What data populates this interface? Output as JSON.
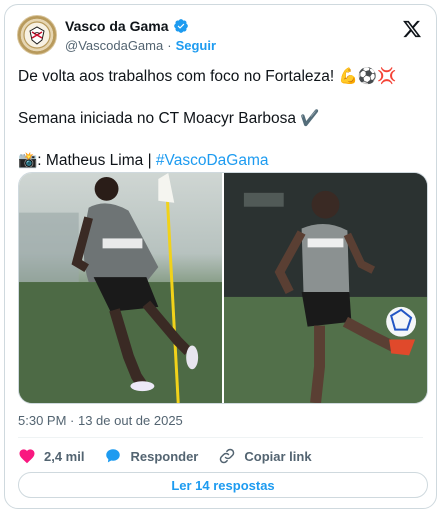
{
  "account": {
    "name": "Vasco da Gama",
    "handle": "@VascodaGama",
    "separator": "·",
    "follow_label": "Seguir"
  },
  "tweet": {
    "line1": "De volta aos trabalhos com foco no Fortaleza! 💪⚽💢",
    "line2": "Semana iniciada no CT Moacyr Barbosa ✔️",
    "credit_prefix": "📸: Matheus Lima | ",
    "hashtag": "#VascoDaGama"
  },
  "timestamp": "5:30 PM · 13 de out de 2025",
  "actions": {
    "likes": "2,4 mil",
    "reply_label": "Responder",
    "copy_link_label": "Copiar link"
  },
  "replies_button": "Ler 14 respostas",
  "photos": {
    "shirt_sponsor": "betfair"
  },
  "colors": {
    "accent": "#1d9bf0",
    "like": "#f91880",
    "text_secondary": "#536471"
  }
}
